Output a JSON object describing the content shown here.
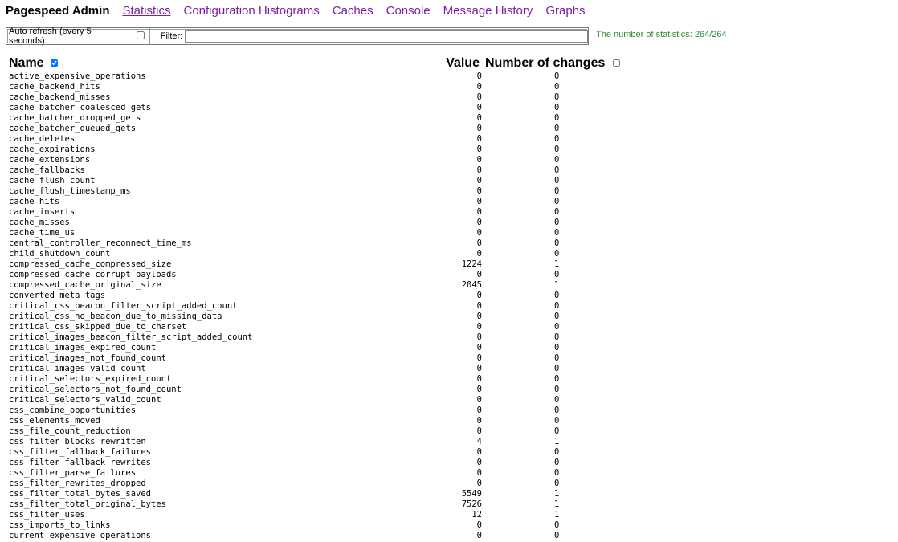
{
  "nav": {
    "brand": "Pagespeed Admin",
    "links": [
      "Statistics",
      "Configuration Histograms",
      "Caches",
      "Console",
      "Message History",
      "Graphs"
    ],
    "current": "Statistics",
    "link_color": "#7b1fa2"
  },
  "controls": {
    "auto_refresh_label": "Auto refresh (every 5 seconds):",
    "auto_refresh_checked": false,
    "filter_label": "Filter:",
    "filter_value": "",
    "count_text": "The number of statistics: 264/264",
    "count_color": "#2e8b2e"
  },
  "table": {
    "headers": {
      "name": "Name",
      "value": "Value",
      "changes": "Number of changes"
    },
    "name_sort_checked": true,
    "changes_sort_checked": false,
    "rows": [
      {
        "name": "active_expensive_operations",
        "value": "0",
        "changes": "0"
      },
      {
        "name": "cache_backend_hits",
        "value": "0",
        "changes": "0"
      },
      {
        "name": "cache_backend_misses",
        "value": "0",
        "changes": "0"
      },
      {
        "name": "cache_batcher_coalesced_gets",
        "value": "0",
        "changes": "0"
      },
      {
        "name": "cache_batcher_dropped_gets",
        "value": "0",
        "changes": "0"
      },
      {
        "name": "cache_batcher_queued_gets",
        "value": "0",
        "changes": "0"
      },
      {
        "name": "cache_deletes",
        "value": "0",
        "changes": "0"
      },
      {
        "name": "cache_expirations",
        "value": "0",
        "changes": "0"
      },
      {
        "name": "cache_extensions",
        "value": "0",
        "changes": "0"
      },
      {
        "name": "cache_fallbacks",
        "value": "0",
        "changes": "0"
      },
      {
        "name": "cache_flush_count",
        "value": "0",
        "changes": "0"
      },
      {
        "name": "cache_flush_timestamp_ms",
        "value": "0",
        "changes": "0"
      },
      {
        "name": "cache_hits",
        "value": "0",
        "changes": "0"
      },
      {
        "name": "cache_inserts",
        "value": "0",
        "changes": "0"
      },
      {
        "name": "cache_misses",
        "value": "0",
        "changes": "0"
      },
      {
        "name": "cache_time_us",
        "value": "0",
        "changes": "0"
      },
      {
        "name": "central_controller_reconnect_time_ms",
        "value": "0",
        "changes": "0"
      },
      {
        "name": "child_shutdown_count",
        "value": "0",
        "changes": "0"
      },
      {
        "name": "compressed_cache_compressed_size",
        "value": "1224",
        "changes": "1"
      },
      {
        "name": "compressed_cache_corrupt_payloads",
        "value": "0",
        "changes": "0"
      },
      {
        "name": "compressed_cache_original_size",
        "value": "2045",
        "changes": "1"
      },
      {
        "name": "converted_meta_tags",
        "value": "0",
        "changes": "0"
      },
      {
        "name": "critical_css_beacon_filter_script_added_count",
        "value": "0",
        "changes": "0"
      },
      {
        "name": "critical_css_no_beacon_due_to_missing_data",
        "value": "0",
        "changes": "0"
      },
      {
        "name": "critical_css_skipped_due_to_charset",
        "value": "0",
        "changes": "0"
      },
      {
        "name": "critical_images_beacon_filter_script_added_count",
        "value": "0",
        "changes": "0"
      },
      {
        "name": "critical_images_expired_count",
        "value": "0",
        "changes": "0"
      },
      {
        "name": "critical_images_not_found_count",
        "value": "0",
        "changes": "0"
      },
      {
        "name": "critical_images_valid_count",
        "value": "0",
        "changes": "0"
      },
      {
        "name": "critical_selectors_expired_count",
        "value": "0",
        "changes": "0"
      },
      {
        "name": "critical_selectors_not_found_count",
        "value": "0",
        "changes": "0"
      },
      {
        "name": "critical_selectors_valid_count",
        "value": "0",
        "changes": "0"
      },
      {
        "name": "css_combine_opportunities",
        "value": "0",
        "changes": "0"
      },
      {
        "name": "css_elements_moved",
        "value": "0",
        "changes": "0"
      },
      {
        "name": "css_file_count_reduction",
        "value": "0",
        "changes": "0"
      },
      {
        "name": "css_filter_blocks_rewritten",
        "value": "4",
        "changes": "1"
      },
      {
        "name": "css_filter_fallback_failures",
        "value": "0",
        "changes": "0"
      },
      {
        "name": "css_filter_fallback_rewrites",
        "value": "0",
        "changes": "0"
      },
      {
        "name": "css_filter_parse_failures",
        "value": "0",
        "changes": "0"
      },
      {
        "name": "css_filter_rewrites_dropped",
        "value": "0",
        "changes": "0"
      },
      {
        "name": "css_filter_total_bytes_saved",
        "value": "5549",
        "changes": "1"
      },
      {
        "name": "css_filter_total_original_bytes",
        "value": "7526",
        "changes": "1"
      },
      {
        "name": "css_filter_uses",
        "value": "12",
        "changes": "1"
      },
      {
        "name": "css_imports_to_links",
        "value": "0",
        "changes": "0"
      },
      {
        "name": "current_expensive_operations",
        "value": "0",
        "changes": "0"
      }
    ]
  }
}
